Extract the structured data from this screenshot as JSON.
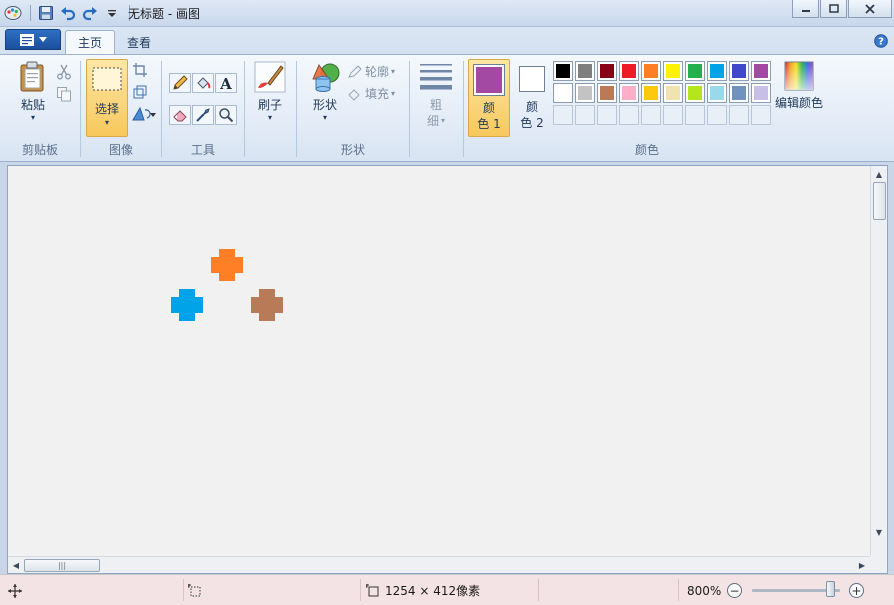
{
  "window": {
    "title": "无标题 - 画图"
  },
  "tabs": [
    {
      "label": "主页",
      "active": true
    },
    {
      "label": "查看",
      "active": false
    }
  ],
  "ribbon": {
    "clipboard": {
      "label": "剪贴板",
      "paste_label": "粘贴"
    },
    "image": {
      "label": "图像",
      "select_label": "选择"
    },
    "tools": {
      "label": "工具"
    },
    "brushes": {
      "label": "刷子"
    },
    "shapes": {
      "label": "形状",
      "shapes_label": "形状",
      "outline_label": "轮廓",
      "fill_label": "填充"
    },
    "size": {
      "label_line1": "粗",
      "label_line2": "细"
    },
    "colors": {
      "label": "颜色",
      "color1_line1": "颜",
      "color1_line2": "色 1",
      "color2_line1": "颜",
      "color2_line2": "色 2",
      "edit_colors_label": "编辑颜色",
      "color1_value": "#a349a4",
      "color2_value": "#ffffff",
      "palette_row1": [
        "#000000",
        "#7f7f7f",
        "#880015",
        "#ed1c24",
        "#ff7f27",
        "#fff200",
        "#22b14c",
        "#00a2e8",
        "#3f48cc",
        "#a349a4"
      ],
      "palette_row2": [
        "#ffffff",
        "#c3c3c3",
        "#b97a57",
        "#ffaec9",
        "#ffc90e",
        "#efe4b0",
        "#b5e61d",
        "#99d9ea",
        "#7092be",
        "#c8bfe7"
      ]
    }
  },
  "canvas": {
    "crosses": [
      {
        "color": "#ff7f27",
        "name": "orange"
      },
      {
        "color": "#00a2e8",
        "name": "blue"
      },
      {
        "color": "#b97a57",
        "name": "brown"
      }
    ]
  },
  "status": {
    "image_size": "1254 × 412像素",
    "zoom": "800%"
  }
}
